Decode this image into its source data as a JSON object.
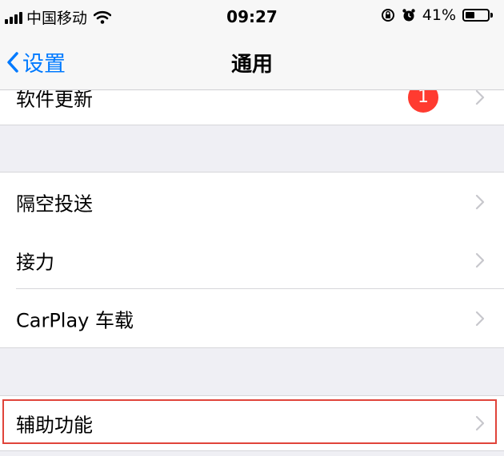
{
  "status_bar": {
    "carrier": "中国移动",
    "time": "09:27",
    "battery_percent": "41%",
    "battery_level": 0.41,
    "icons": [
      "signal-bars-icon",
      "wifi-icon",
      "orientation-lock-icon",
      "alarm-icon",
      "battery-icon"
    ]
  },
  "nav": {
    "back_label": "设置",
    "title": "通用"
  },
  "rows": {
    "software_update": {
      "label": "软件更新",
      "badge": "1"
    },
    "airdrop": {
      "label": "隔空投送"
    },
    "handoff": {
      "label": "接力"
    },
    "carplay": {
      "label": "CarPlay 车载"
    },
    "accessibility": {
      "label": "辅助功能"
    }
  },
  "colors": {
    "accent": "#007aff",
    "badge": "#ff3b30",
    "highlight_border": "#e0443a",
    "background": "#efeff4"
  }
}
